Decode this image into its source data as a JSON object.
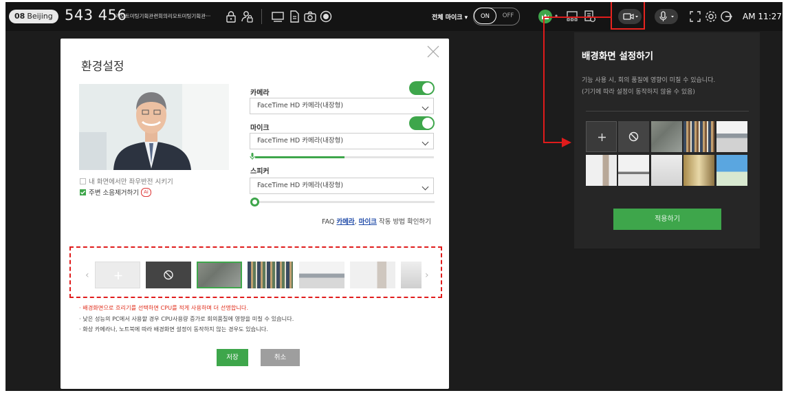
{
  "topbar": {
    "room_badge_num": "08",
    "room_badge_city": "Beijing",
    "room_number": "543 456",
    "room_title": "리모트미팅기획관련회의리모트미팅기획관···",
    "mic_all_label": "전체 마이크 ▾",
    "on_label": "ON",
    "off_label": "OFF",
    "time": "AM 11:27"
  },
  "dialog": {
    "title": "환경설정",
    "mirror_label": "내 화면에서만 좌우반전 시키기",
    "noise_label": "주변 소음제거하기",
    "ai_badge": "Ai",
    "camera_label": "카메라",
    "camera_device": "FaceTime HD 카메라(내장형)",
    "mic_label": "마이크",
    "mic_device": "FaceTime HD 카메라(내장형)",
    "mic_level_pct": 50,
    "speaker_label": "스피커",
    "speaker_device": "FaceTime HD 카메라(내장형)",
    "faq_prefix": "FAQ ",
    "faq_camera": "카메라",
    "faq_comma": ", ",
    "faq_mic": "마이크",
    "faq_suffix": " 작동 방법 확인하기",
    "note1": "· 배경화면으로 흐리기를 선택하면 CPU를 적게 사용하며 더 선명합니다.",
    "note2": "· 낮은 성능의 PC에서 사용할 경우 CPU사용량 증가로 회의품질에 영향을 미칠 수 있습니다.",
    "note3": "· 화상 카메라나, 노트북에 따라 배경화면 설정이 동작하지 않는 경우도 있습니다.",
    "save_label": "저장",
    "cancel_label": "취소"
  },
  "bgpanel": {
    "title": "배경화면 설정하기",
    "desc_line1": "기능 사용 시, 회의 품질에 영향이 미칠 수 있습니다.",
    "desc_line2": "(기기에 따라 설정이 동작하지 않을 수 있음)",
    "apply_label": "적용하기"
  },
  "colors": {
    "accent": "#3ea64b",
    "annotation": "#e01b1b",
    "panel_bg": "#262626",
    "app_bg": "#1c1c1c"
  }
}
